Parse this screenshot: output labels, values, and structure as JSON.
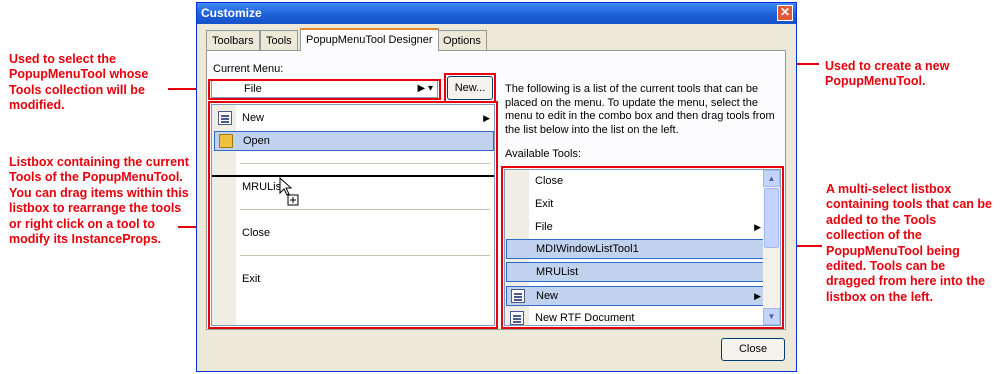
{
  "annotations": {
    "combo_note": "Used to select the PopupMenuTool whose Tools collection will be modified.",
    "listbox_note": "Listbox containing the current Tools of the PopupMenuTool. You can drag items within this listbox to rearrange the tools or right click on a tool to modify its InstanceProps.",
    "new_note": "Used to create a new PopupMenuTool.",
    "available_note": "A multi-select listbox containing tools that can be added to the Tools collection of the PopupMenuTool being edited. Tools can be dragged from here into the listbox on the left."
  },
  "window": {
    "title": "Customize",
    "close_glyph": "✕",
    "tabs": [
      "Toolbars",
      "Tools",
      "PopupMenuTool Designer",
      "Options"
    ],
    "active_tab": "PopupMenuTool Designer"
  },
  "designer": {
    "current_menu_label": "Current Menu:",
    "current_menu_value": "File",
    "combo_arrows": "▶ ▾",
    "new_button": "New...",
    "description": "The following is a list of the current tools that can be placed on the menu. To update the menu, select the menu to edit in the combo box and then drag tools from the list below into the list on the left.",
    "available_label": "Available Tools:",
    "menu_items": [
      {
        "label": "New",
        "icon": "doc-icon",
        "submenu": true
      },
      {
        "label": "Open",
        "icon": "folder-open-icon",
        "selected": true
      },
      {
        "label": "MRUList"
      },
      {
        "label": "Close"
      },
      {
        "label": "Exit"
      }
    ],
    "available_tools": [
      {
        "label": "Close"
      },
      {
        "label": "Exit"
      },
      {
        "label": "File",
        "submenu": true
      },
      {
        "label": "MDIWindowListTool1",
        "selected": true
      },
      {
        "label": "MRUList",
        "selected": true
      },
      {
        "label": "New",
        "icon": "doc-icon",
        "selected": true,
        "submenu": true
      },
      {
        "label": "New RTF Document",
        "icon": "doc-icon"
      }
    ],
    "close_button": "Close"
  },
  "colors": {
    "annotation": "#e8000b",
    "selection": "#c1d2ee",
    "title_bar": "#1e5fd8"
  }
}
